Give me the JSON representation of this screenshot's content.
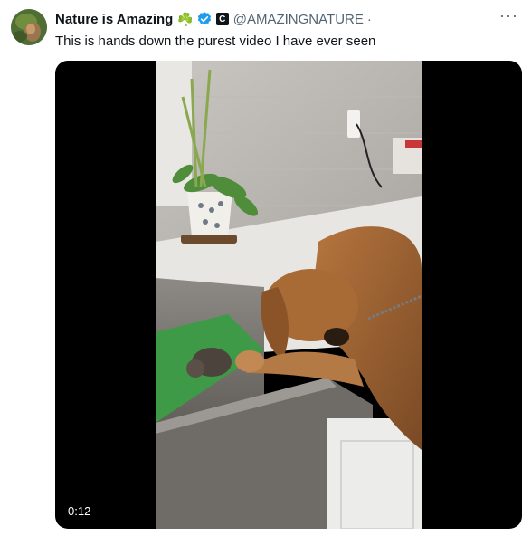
{
  "tweet": {
    "author_name": "Nature is Amazing",
    "name_emoji": "☘️",
    "handle": "@AMAZINGNATURE",
    "separator": "·",
    "text": "This is hands down the purest video I have ever seen",
    "more_label": "···"
  },
  "icons": {
    "verified": "verified-badge-icon",
    "affiliate": "affiliate-badge-icon",
    "more": "more-options-icon"
  },
  "media": {
    "duration": "0:12"
  },
  "colors": {
    "verified_blue": "#1d9bf0",
    "secondary_text": "#536471",
    "primary_text": "#0f1419"
  }
}
